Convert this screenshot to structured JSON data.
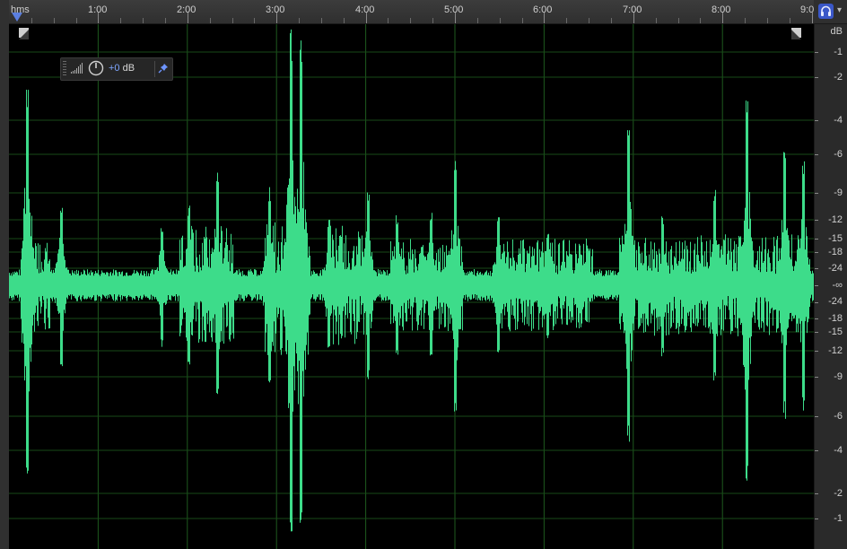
{
  "time_ruler": {
    "format_label": "hms",
    "ticks": [
      "1:00",
      "2:00",
      "3:00",
      "4:00",
      "5:00",
      "6:00",
      "7:00",
      "8:00",
      "9:0"
    ]
  },
  "hud": {
    "value_num": "+0",
    "value_unit": " dB"
  },
  "db_ruler": {
    "unit_label": "dB",
    "labels": [
      "-1",
      "-2",
      "-4",
      "-6",
      "-9",
      "-12",
      "-15",
      "-18",
      "-24",
      "-∞",
      "-24",
      "-18",
      "-15",
      "-12",
      "-9",
      "-6",
      "-4",
      "-2",
      "-1"
    ]
  },
  "colors": {
    "waveform": "#3ddc8a",
    "background": "#000000",
    "playhead": "#5b7fe0",
    "accent": "#3a57c8"
  },
  "icons": [
    "headphone-icon",
    "menu-caret-icon",
    "playhead-icon",
    "fade-in-handle",
    "fade-out-handle",
    "level-meter-icon",
    "volume-knob-icon",
    "pin-icon"
  ]
}
